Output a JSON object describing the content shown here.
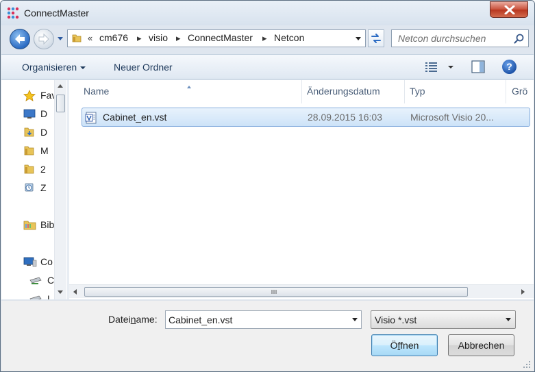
{
  "window": {
    "title": "ConnectMaster"
  },
  "colors": {
    "accent": "#3c7fb1",
    "selection": "#cde3f8",
    "close": "#c9503a"
  },
  "address": {
    "overflow": "«",
    "parts": [
      "cm676",
      "visio",
      "ConnectMaster",
      "Netcon"
    ],
    "separator": "▸"
  },
  "search": {
    "placeholder": "Netcon durchsuchen"
  },
  "toolbar": {
    "organize": "Organisieren",
    "new_folder": "Neuer Ordner"
  },
  "navpane": {
    "items": [
      {
        "icon": "star-icon",
        "label": "Fav"
      },
      {
        "icon": "desktop-icon",
        "label": "D"
      },
      {
        "icon": "downloads-folder-icon",
        "label": "D"
      },
      {
        "icon": "folder-icon",
        "label": "M"
      },
      {
        "icon": "folder-icon",
        "label": "2"
      },
      {
        "icon": "recent-places-icon",
        "label": "Z"
      },
      {
        "icon": "libraries-icon",
        "label": "Bib"
      },
      {
        "icon": "computer-icon",
        "label": "Co"
      },
      {
        "icon": "network-drive-icon",
        "label": "C"
      },
      {
        "icon": "drive-icon",
        "label": "L"
      }
    ]
  },
  "columns": {
    "name": "Name",
    "date": "Änderungsdatum",
    "type": "Typ",
    "size": "Grö"
  },
  "files": [
    {
      "icon": "visio-file-icon",
      "name": "Cabinet_en.vst",
      "date": "28.09.2015 16:03",
      "type": "Microsoft Visio 20..."
    }
  ],
  "bottom": {
    "filename_label_pre": "Datei",
    "filename_label_u": "n",
    "filename_label_post": "ame:",
    "filename_value": "Cabinet_en.vst",
    "filter_value": "Visio *.vst",
    "open_pre": "Ö",
    "open_u": "f",
    "open_post": "fnen",
    "cancel": "Abbrechen"
  }
}
